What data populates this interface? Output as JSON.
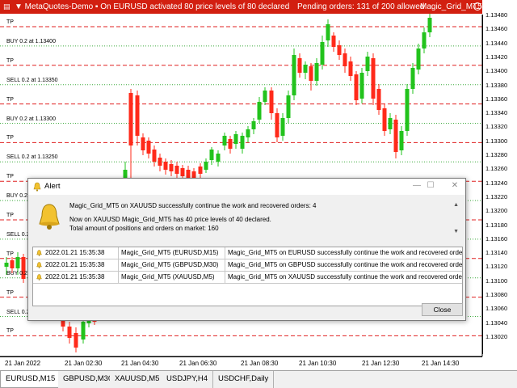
{
  "status_bar": {
    "menu_icon": "chart-menu-icon",
    "title": "▼ MetaQuotes-Demo ▪ On EURUSD activated 80 price levels of 80 declared",
    "pending": "Pending orders: 131 of 200 allowed",
    "ea_name": "Magic_Grid_MT5",
    "bg_color": "#d21f10"
  },
  "chart": {
    "price_labels": [
      "1.13480",
      "1.13460",
      "1.13440",
      "1.13420",
      "1.13400",
      "1.13380",
      "1.13360",
      "1.13340",
      "1.13320",
      "1.13300",
      "1.13280",
      "1.13260",
      "1.13240",
      "1.13220",
      "1.13200",
      "1.13180",
      "1.13160",
      "1.13140",
      "1.13120",
      "1.13100",
      "1.13080",
      "1.13060",
      "1.13040",
      "1.13020"
    ],
    "time_labels": [
      "21 Jan 2022",
      "21 Jan 02:30",
      "21 Jan 04:30",
      "21 Jan 06:30",
      "21 Jan 08:30",
      "21 Jan 10:30",
      "21 Jan 12:30",
      "21 Jan 14:30"
    ],
    "level_labels": [
      "TP",
      "BUY 0.2 at 1.13400",
      "TP",
      "SELL 0.2 at 1.13350",
      "TP",
      "BUY 0.2 at 1.13300",
      "TP",
      "SELL 0.2 at 1.13250",
      "TP",
      "BUY 0.2",
      "TP",
      "SELL 0.2",
      "TP",
      "BUY 0.2",
      "TP",
      "SELL 0.2",
      "TP"
    ],
    "bull_color": "#22c31c",
    "bear_color": "#ff2a1a",
    "tp_line_color": "#e02020",
    "order_line_color": "#3caa3c"
  },
  "alert": {
    "title": "Alert",
    "messages": [
      "Magic_Grid_MT5 on XAUUSD successfully continue the work and recovered orders: 4",
      "Now on XAUUSD Magic_Grid_MT5 has 40 price levels of 40 declared.",
      "Total amount of positions and orders on market: 160"
    ],
    "rows": [
      {
        "time": "2022.01.21 15:35:38",
        "source": "Magic_Grid_MT5 (EURUSD,M15)",
        "message": "Magic_Grid_MT5 on EURUSD successfully continue the work and recovered orders: 1"
      },
      {
        "time": "2022.01.21 15:35:38",
        "source": "Magic_Grid_MT5 (GBPUSD,M30)",
        "message": "Magic_Grid_MT5 on GBPUSD successfully continue the work and recovered orders: 3"
      },
      {
        "time": "2022.01.21 15:35:38",
        "source": "Magic_Grid_MT5 (XAUUSD,M5)",
        "message": "Magic_Grid_MT5 on XAUUSD successfully continue the work and recovered orders: 4"
      }
    ],
    "close_label": "Close",
    "bell_color": "#f2c230"
  },
  "tabs": [
    {
      "label": "EURUSD,M15",
      "active": true
    },
    {
      "label": "GBPUSD,M30",
      "active": false
    },
    {
      "label": "XAUUSD,M5",
      "active": false
    },
    {
      "label": "USDJPY,H4",
      "active": false
    },
    {
      "label": "USDCHF,Daily",
      "active": false
    }
  ]
}
